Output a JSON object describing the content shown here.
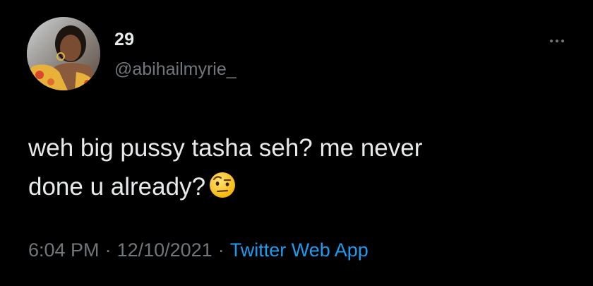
{
  "user": {
    "display_name": "29",
    "handle": "@abihailmyrie_",
    "avatar_icon": "profile-photo"
  },
  "tweet": {
    "line1": "weh big pussy tasha seh? me never",
    "line2": "done u already?",
    "emoji": "face-with-raised-eyebrow-icon"
  },
  "meta": {
    "time": "6:04 PM",
    "separator": "·",
    "date": "12/10/2021",
    "source": "Twitter Web App"
  },
  "colors": {
    "background": "#000000",
    "text": "#e7e9ea",
    "secondary": "#71767b",
    "link": "#1d9bf0"
  }
}
